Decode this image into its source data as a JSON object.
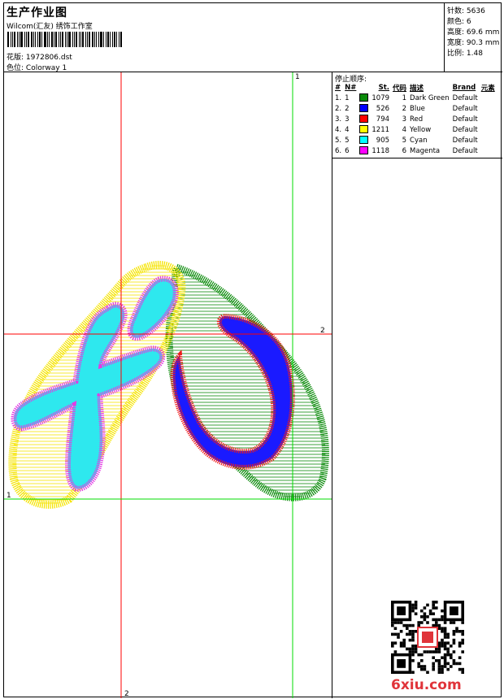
{
  "header": {
    "title": "生产作业图",
    "studio": "Wilcom(汇友) 绣饰工作室",
    "design_label": "花版:",
    "design_value": "1972806.dst",
    "colorway_label": "色位:",
    "colorway_value": "Colorway 1"
  },
  "stats": {
    "stitches_label": "针数:",
    "stitches_value": "5636",
    "colors_label": "颜色:",
    "colors_value": "6",
    "height_label": "高度:",
    "height_value": "69.6 mm",
    "width_label": "宽度:",
    "width_value": "90.3 mm",
    "scale_label": "比例:",
    "scale_value": "1.48"
  },
  "legend": {
    "heading": "停止顺序:",
    "columns": [
      "#",
      "N#",
      "St.",
      "代码",
      "描述",
      "Brand",
      "元素"
    ],
    "rows": [
      {
        "idx": "1.",
        "n": "1",
        "color": "#0a8a0a",
        "st": "1079",
        "code": "1",
        "desc": "Dark Green",
        "brand": "Default"
      },
      {
        "idx": "2.",
        "n": "2",
        "color": "#0000ff",
        "st": "526",
        "code": "2",
        "desc": "Blue",
        "brand": "Default"
      },
      {
        "idx": "3.",
        "n": "3",
        "color": "#ff0000",
        "st": "794",
        "code": "3",
        "desc": "Red",
        "brand": "Default"
      },
      {
        "idx": "4.",
        "n": "4",
        "color": "#ffff00",
        "st": "1211",
        "code": "4",
        "desc": "Yellow",
        "brand": "Default"
      },
      {
        "idx": "5.",
        "n": "5",
        "color": "#00ffff",
        "st": "905",
        "code": "5",
        "desc": "Cyan",
        "brand": "Default"
      },
      {
        "idx": "6.",
        "n": "6",
        "color": "#ff00ff",
        "st": "1118",
        "code": "6",
        "desc": "Magenta",
        "brand": "Default"
      }
    ]
  },
  "guides": {
    "v_red_top": "",
    "v_red_bottom": "2",
    "v_green_top": "1",
    "h_red_right": "2",
    "h_green_left": "1"
  },
  "watermark": "6xiu.com"
}
